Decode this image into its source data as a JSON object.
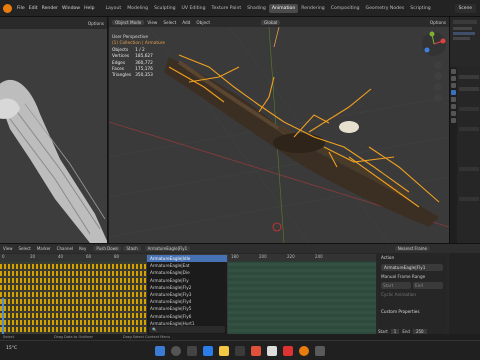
{
  "topbar": {
    "menus": [
      "File",
      "Edit",
      "Render",
      "Window",
      "Help"
    ],
    "workspaces": [
      "Layout",
      "Modeling",
      "Sculpting",
      "UV Editing",
      "Texture Paint",
      "Shading",
      "Animation",
      "Rendering",
      "Compositing",
      "Geometry Nodes",
      "Scripting"
    ],
    "active_workspace": "Animation",
    "scene": "Scene"
  },
  "left_view": {
    "options_label": "Options"
  },
  "main_view": {
    "header": {
      "mode": "Object Mode",
      "view": "View",
      "select": "Select",
      "add": "Add",
      "object": "Object",
      "orientation": "Global",
      "options": "Options"
    },
    "overlay": {
      "perspective": "User Perspective",
      "collection": "(1) Collection | Armature",
      "stats": [
        {
          "label": "Objects",
          "value": "1 / 2"
        },
        {
          "label": "Vertices",
          "value": "185,627"
        },
        {
          "label": "Edges",
          "value": "360,772"
        },
        {
          "label": "Faces",
          "value": "175,176"
        },
        {
          "label": "Triangles",
          "value": "350,353"
        }
      ]
    }
  },
  "dopesheet": {
    "header": [
      "View",
      "Select",
      "Marker",
      "Channel",
      "Key"
    ],
    "push_down": "Push Down",
    "stash": "Stash",
    "action_name": "ArmatureEagle|Fly1",
    "keying": "Keying",
    "ruler": [
      "0",
      "20",
      "40",
      "60",
      "80",
      "100",
      "120",
      "140",
      "160",
      "180",
      "200",
      "220",
      "240"
    ],
    "nearest_frame": "Nearest Frame"
  },
  "action_dropdown": {
    "items": [
      "ArmatureEagle|Idle",
      "ArmatureEagle|Eat",
      "ArmatureEagle|Die",
      "ArmatureEagle|Fly",
      "ArmatureEagle|Fly2",
      "ArmatureEagle|Fly3",
      "ArmatureEagle|Fly4",
      "ArmatureEagle|Fly5",
      "ArmatureEagle|Fly6",
      "ArmatureEagle|Hurt1"
    ],
    "selected_index": 0,
    "search_placeholder": "🔍"
  },
  "side_panel": {
    "action_section": "Action",
    "action_value": "ArmatureEagle|Fly1",
    "manual_frame_range": "Manual Frame Range",
    "start_label": "Start",
    "end_label": "End",
    "cyclic_label": "Cyclic Animation",
    "custom_properties": "Custom Properties"
  },
  "timeline_controls": {
    "start_label": "Start",
    "start_value": "1",
    "end_label": "End",
    "end_value": "250"
  },
  "status": {
    "left": "Select",
    "middle": "Drag Data to Outliner",
    "right": "Drag Select Context Menu"
  },
  "taskbar": {
    "weather": "15°C",
    "time": "",
    "date": ""
  }
}
